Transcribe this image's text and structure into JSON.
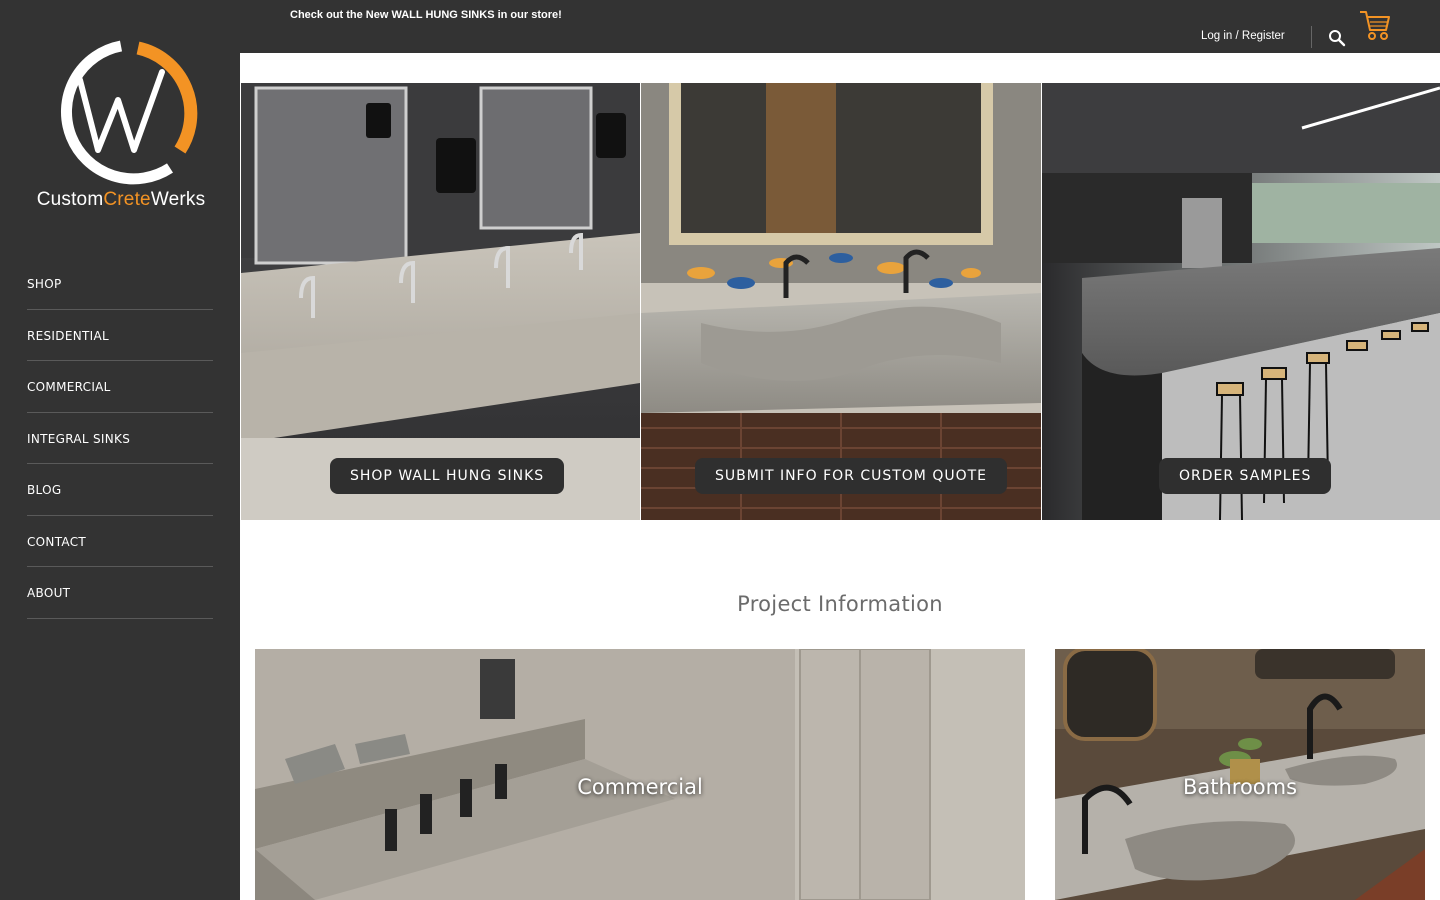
{
  "announcement": "Check out the New WALL HUNG SINKS in our store!",
  "logo": {
    "brand_part1": "Custom",
    "brand_part2": "Crete",
    "brand_part3": "Werks",
    "accent_color": "#f39324"
  },
  "nav": {
    "items": [
      {
        "label": "SHOP"
      },
      {
        "label": "RESIDENTIAL"
      },
      {
        "label": "COMMERCIAL"
      },
      {
        "label": "INTEGRAL SINKS"
      },
      {
        "label": "BLOG"
      },
      {
        "label": "CONTACT"
      },
      {
        "label": "ABOUT"
      }
    ]
  },
  "header": {
    "login_label": "Log in / Register",
    "search_icon": "search-icon",
    "cart_icon": "cart-icon"
  },
  "hero": {
    "tiles": [
      {
        "button": "SHOP WALL HUNG SINKS"
      },
      {
        "button": "SUBMIT INFO FOR CUSTOM QUOTE"
      },
      {
        "button": "ORDER SAMPLES"
      }
    ]
  },
  "projects": {
    "title": "Project Information",
    "cards": [
      {
        "label": "Commercial"
      },
      {
        "label": "Bathrooms"
      }
    ]
  },
  "colors": {
    "sidebar_bg": "#333333",
    "button_bg": "#2f2f2f",
    "title_gray": "#6b6b6b"
  }
}
